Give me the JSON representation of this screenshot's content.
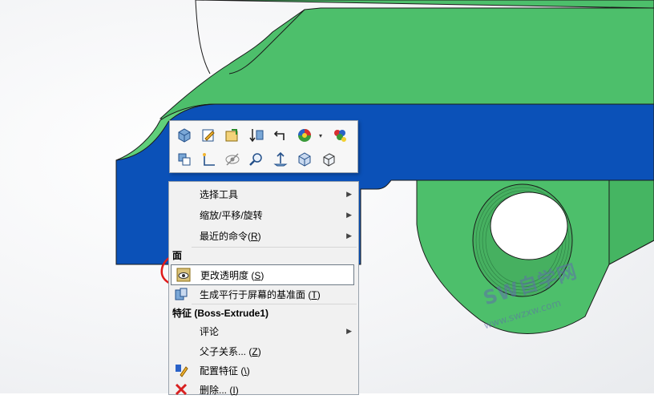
{
  "toolbar": {
    "row1": [
      "select-other-icon",
      "edit-sketch-icon",
      "insert-part-icon",
      "hide-show-icon",
      "parent-child-icon",
      "appearance-icon",
      "appearance-dropdown-icon",
      "materials-icon"
    ],
    "row2": [
      "view-selector-icon",
      "sketch-corner-icon",
      "hide-icon",
      "zoom-to-selection-icon",
      "normal-to-icon",
      "view-orientation-icon",
      "isometric-icon"
    ]
  },
  "menu": {
    "select_tools": "选择工具",
    "zoom_pan_rotate": "缩放/平移/旋转",
    "recent_commands_text": "最近的命令(",
    "recent_commands_key": "R",
    "recent_commands_end": ")",
    "face_header": "面",
    "change_transparency_text": "更改透明度 (",
    "change_transparency_key": "S",
    "change_transparency_end": ")",
    "parallel_plane_text": "生成平行于屏幕的基准面 (",
    "parallel_plane_key": "T",
    "parallel_plane_end": ")",
    "feature_header": "特征 (Boss-Extrude1)",
    "comment": "评论",
    "parent_child_text": "父子关系... (",
    "parent_child_key": "Z",
    "parent_child_end": ")",
    "config_feature_text": "配置特征 (",
    "config_feature_key": "\\",
    "config_feature_end": ")",
    "delete_text": "删除... (",
    "delete_key": "I",
    "delete_end": ")",
    "submenu_arrow": "▶"
  },
  "watermark": {
    "title": "SW自学网",
    "url": "www.swzxw.com"
  },
  "colors": {
    "model_green": "#4dbf6b",
    "model_green_dark": "#3aa858",
    "selected_face_blue": "#0b51b8",
    "annotation_red": "#e01a1a"
  }
}
